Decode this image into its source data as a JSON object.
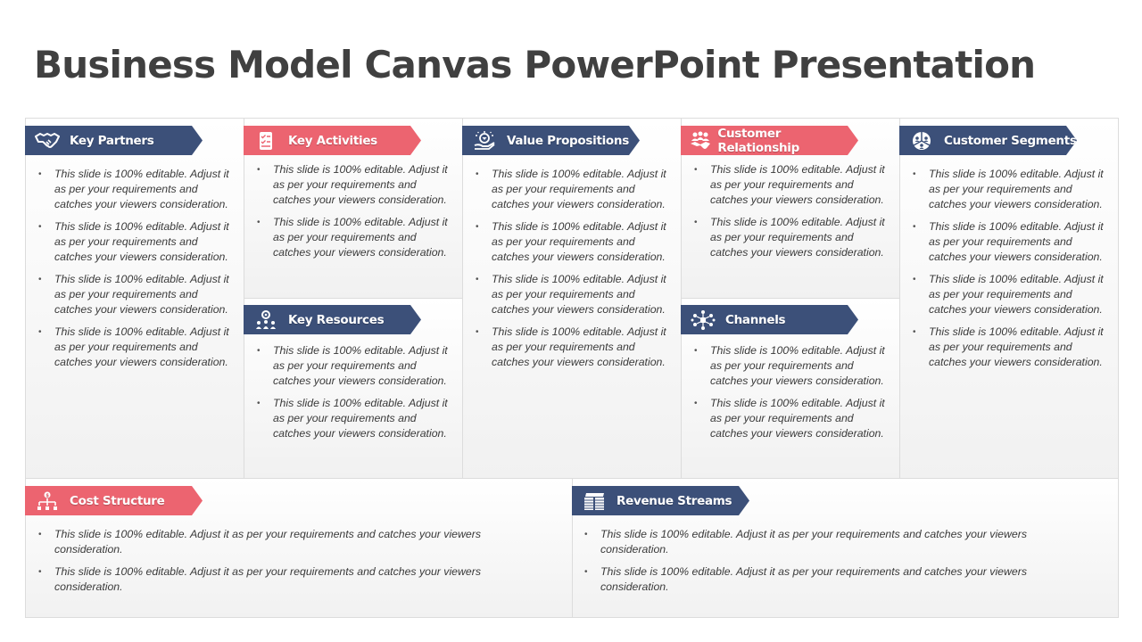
{
  "title": "Business Model Canvas PowerPoint Presentation",
  "colors": {
    "navy": "#3c5079",
    "coral": "#ec6470",
    "title": "#404040",
    "border": "#dcdcdc"
  },
  "sections": {
    "key_partners": {
      "label": "Key Partners",
      "icon": "handshake-icon",
      "bullets": [
        "This slide is 100% editable. Adjust it as per your requirements and catches your viewers consideration.",
        "This slide is 100% editable. Adjust it as per your requirements and catches your viewers consideration.",
        "This slide is 100% editable. Adjust it as per your requirements and catches your viewers consideration.",
        "This slide is 100% editable. Adjust it as per your requirements and catches your viewers consideration."
      ]
    },
    "key_activities": {
      "label": "Key Activities",
      "icon": "checklist-icon",
      "bullets": [
        "This slide is 100% editable. Adjust it as per your requirements and catches your viewers consideration.",
        "This slide is 100% editable. Adjust it as per your requirements and catches your viewers consideration."
      ]
    },
    "key_resources": {
      "label": "Key Resources",
      "icon": "team-gear-icon",
      "bullets": [
        "This slide is 100% editable. Adjust it as per your requirements and catches your viewers consideration.",
        "This slide is 100% editable. Adjust it as per your requirements and catches your viewers consideration."
      ]
    },
    "value_propositions": {
      "label": "Value Propositions",
      "icon": "hand-diamond-icon",
      "bullets": [
        "This slide is 100% editable. Adjust it as per your requirements and catches your viewers consideration.",
        "This slide is 100% editable. Adjust it as per your requirements and catches your viewers consideration.",
        "This slide is 100% editable. Adjust it as per your requirements and catches your viewers consideration.",
        "This slide is 100% editable. Adjust it as per your requirements and catches your viewers consideration."
      ]
    },
    "customer_relationship": {
      "label": "Customer Relationship",
      "icon": "people-handshake-icon",
      "bullets": [
        "This slide is 100% editable. Adjust it as per your requirements and catches your viewers consideration.",
        "This slide is 100% editable. Adjust it as per your requirements and catches your viewers consideration."
      ]
    },
    "channels": {
      "label": "Channels",
      "icon": "network-icon",
      "bullets": [
        "This slide is 100% editable. Adjust it as per your requirements and catches your viewers consideration.",
        "This slide is 100% editable. Adjust it as per your requirements and catches your viewers consideration."
      ]
    },
    "customer_segments": {
      "label": "Customer Segments",
      "icon": "segments-pie-icon",
      "bullets": [
        "This slide is 100% editable. Adjust it as per your requirements and catches your viewers consideration.",
        "This slide is 100% editable. Adjust it as per your requirements and catches your viewers consideration.",
        "This slide is 100% editable. Adjust it as per your requirements and catches your viewers consideration.",
        "This slide is 100% editable. Adjust it as per your requirements and catches your viewers consideration."
      ]
    },
    "cost_structure": {
      "label": "Cost Structure",
      "icon": "cost-hierarchy-icon",
      "bullets": [
        "This slide is 100% editable. Adjust it as per your requirements and catches your viewers consideration.",
        "This slide is 100% editable. Adjust it as per your requirements and catches your viewers consideration."
      ]
    },
    "revenue_streams": {
      "label": "Revenue Streams",
      "icon": "cash-stack-icon",
      "bullets": [
        "This slide is 100% editable. Adjust it as per your requirements and catches your viewers consideration.",
        "This slide is 100% editable. Adjust it as per your requirements and catches your viewers consideration."
      ]
    }
  }
}
